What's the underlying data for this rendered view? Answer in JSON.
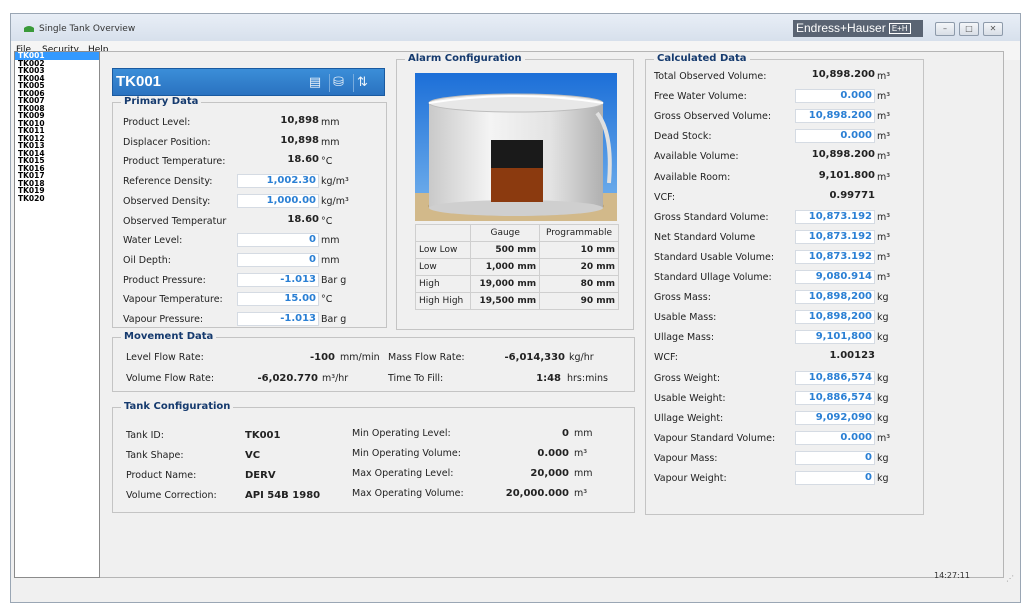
{
  "window": {
    "title": "Single Tank Overview",
    "brand": "Endress+Hauser",
    "brand_mark": "E+H"
  },
  "menu": [
    "File",
    "Security",
    "Help"
  ],
  "tanks": [
    "TK001",
    "TK002",
    "TK003",
    "TK004",
    "TK005",
    "TK006",
    "TK007",
    "TK008",
    "TK009",
    "TK010",
    "TK011",
    "TK012",
    "TK013",
    "TK014",
    "TK015",
    "TK016",
    "TK017",
    "TK018",
    "TK019",
    "TK020"
  ],
  "selected_tank": "TK001",
  "primary": {
    "title": "Primary Data",
    "rows": [
      {
        "label": "Product Level:",
        "value": "10,898",
        "unit": "mm",
        "editable": false
      },
      {
        "label": "Displacer Position:",
        "value": "10,898",
        "unit": "mm",
        "editable": false
      },
      {
        "label": "Product Temperature:",
        "value": "18.60",
        "unit": "°C",
        "editable": false
      },
      {
        "label": "Reference Density:",
        "value": "1,002.30",
        "unit": "kg/m³",
        "editable": true
      },
      {
        "label": "Observed Density:",
        "value": "1,000.00",
        "unit": "kg/m³",
        "editable": true
      },
      {
        "label": "Observed Temperatur",
        "value": "18.60",
        "unit": "°C",
        "editable": false
      },
      {
        "label": "Water Level:",
        "value": "0",
        "unit": "mm",
        "editable": true
      },
      {
        "label": "Oil Depth:",
        "value": "0",
        "unit": "mm",
        "editable": true
      },
      {
        "label": "Product Pressure:",
        "value": "-1.013",
        "unit": "Bar g",
        "editable": true
      },
      {
        "label": "Vapour Temperature:",
        "value": "15.00",
        "unit": "°C",
        "editable": true
      },
      {
        "label": "Vapour Pressure:",
        "value": "-1.013",
        "unit": "Bar g",
        "editable": true
      }
    ]
  },
  "alarm": {
    "title": "Alarm Configuration",
    "headers": [
      "",
      "Gauge",
      "Programmable"
    ],
    "rows": [
      [
        "Low Low",
        "500 mm",
        "10 mm"
      ],
      [
        "Low",
        "1,000 mm",
        "20 mm"
      ],
      [
        "High",
        "19,000 mm",
        "80 mm"
      ],
      [
        "High High",
        "19,500 mm",
        "90 mm"
      ]
    ]
  },
  "movement": {
    "title": "Movement Data",
    "level_flow": {
      "label": "Level Flow Rate:",
      "value": "-100",
      "unit": "mm/min"
    },
    "volume_flow": {
      "label": "Volume Flow Rate:",
      "value": "-6,020.770",
      "unit": "m³/hr"
    },
    "mass_flow": {
      "label": "Mass Flow Rate:",
      "value": "-6,014,330",
      "unit": "kg/hr"
    },
    "time_to_fill": {
      "label": "Time To Fill:",
      "value": "1:48",
      "unit": "hrs:mins"
    }
  },
  "tankconfig": {
    "title": "Tank Configuration",
    "left": [
      {
        "label": "Tank ID:",
        "value": "TK001"
      },
      {
        "label": "Tank Shape:",
        "value": "VC"
      },
      {
        "label": "Product Name:",
        "value": "DERV"
      },
      {
        "label": "Volume Correction:",
        "value": "API 54B 1980"
      }
    ],
    "right": [
      {
        "label": "Min Operating Level:",
        "value": "0",
        "unit": "mm"
      },
      {
        "label": "Min Operating Volume:",
        "value": "0.000",
        "unit": "m³"
      },
      {
        "label": "Max Operating Level:",
        "value": "20,000",
        "unit": "mm"
      },
      {
        "label": "Max Operating Volume:",
        "value": "20,000.000",
        "unit": "m³"
      }
    ]
  },
  "calculated": {
    "title": "Calculated Data",
    "rows": [
      {
        "label": "Total Observed Volume:",
        "value": "10,898.200",
        "unit": "m³",
        "editable": false
      },
      {
        "label": "Free Water Volume:",
        "value": "0.000",
        "unit": "m³",
        "editable": true
      },
      {
        "label": "Gross Observed Volume:",
        "value": "10,898.200",
        "unit": "m³",
        "editable": true
      },
      {
        "label": "Dead Stock:",
        "value": "0.000",
        "unit": "m³",
        "editable": true
      },
      {
        "label": "Available Volume:",
        "value": "10,898.200",
        "unit": "m³",
        "editable": false
      },
      {
        "label": "Available Room:",
        "value": "9,101.800",
        "unit": "m³",
        "editable": false
      },
      {
        "label": "VCF:",
        "value": "0.99771",
        "unit": "",
        "editable": false
      },
      {
        "label": "Gross Standard Volume:",
        "value": "10,873.192",
        "unit": "m³",
        "editable": true
      },
      {
        "label": "Net Standard Volume",
        "value": "10,873.192",
        "unit": "m³",
        "editable": true
      },
      {
        "label": "Standard Usable Volume:",
        "value": "10,873.192",
        "unit": "m³",
        "editable": true
      },
      {
        "label": "Standard Ullage Volume:",
        "value": "9,080.914",
        "unit": "m³",
        "editable": true
      },
      {
        "label": "Gross Mass:",
        "value": "10,898,200",
        "unit": "kg",
        "editable": true
      },
      {
        "label": "Usable Mass:",
        "value": "10,898,200",
        "unit": "kg",
        "editable": true
      },
      {
        "label": "Ullage Mass:",
        "value": "9,101,800",
        "unit": "kg",
        "editable": true
      },
      {
        "label": "WCF:",
        "value": "1.00123",
        "unit": "",
        "editable": false
      },
      {
        "label": "Gross Weight:",
        "value": "10,886,574",
        "unit": "kg",
        "editable": true
      },
      {
        "label": "Usable Weight:",
        "value": "10,886,574",
        "unit": "kg",
        "editable": true
      },
      {
        "label": "Ullage Weight:",
        "value": "9,092,090",
        "unit": "kg",
        "editable": true
      },
      {
        "label": "Vapour Standard Volume:",
        "value": "0.000",
        "unit": "m³",
        "editable": true
      },
      {
        "label": "Vapour Mass:",
        "value": "0",
        "unit": "kg",
        "editable": true
      },
      {
        "label": "Vapour Weight:",
        "value": "0",
        "unit": "kg",
        "editable": true
      }
    ]
  },
  "status": {
    "time": "14:27:11"
  },
  "colors": {
    "accent": "#2a72c0",
    "value_blue": "#2a7fd4",
    "product": "#8b3a0f",
    "vapour_space": "#1a1a1a"
  }
}
